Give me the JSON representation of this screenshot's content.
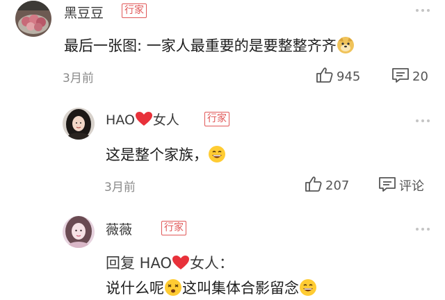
{
  "comments": [
    {
      "username": "黑豆豆",
      "badge": "行家",
      "text": "最后一张图: 一家人最重要的是要整整齐齐",
      "time": "3月前",
      "likes": "945",
      "replies": "20",
      "text_emoji": "doge-emoji"
    },
    {
      "username_prefix": "HAO",
      "username_suffix": "女人",
      "badge": "行家",
      "text": "这是整个家族，",
      "time": "3月前",
      "likes": "207",
      "reply_label": "评论",
      "text_emoji": "grin-emoji"
    },
    {
      "username": "薇薇",
      "badge": "行家",
      "reply_prefix": "回复 HAO",
      "reply_suffix": "女人：",
      "text_part1": "说什么呢",
      "text_part2": "这叫集体合影留念"
    }
  ],
  "colors": {
    "badge": "#e05757",
    "heart": "#e8313a",
    "muted": "#8a8a8a"
  }
}
